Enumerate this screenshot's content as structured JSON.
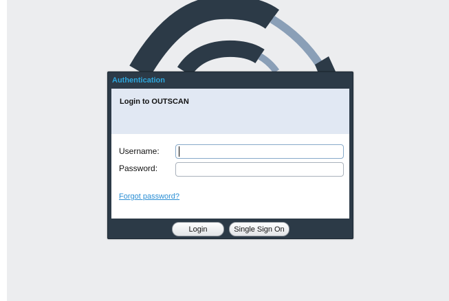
{
  "dialog": {
    "title": "Authentication",
    "heading": "Login to OUTSCAN"
  },
  "form": {
    "username_label": "Username:",
    "username_value": "",
    "password_label": "Password:",
    "password_value": "",
    "forgot_link": "Forgot password?"
  },
  "buttons": {
    "login": "Login",
    "single_sign_on": "Single Sign On"
  },
  "colors": {
    "dialog_frame": "#2c3a47",
    "title_accent": "#2ea6dc",
    "header_band": "#e1e8f3",
    "link": "#2a8ed4",
    "logo_dark": "#2c3a47",
    "logo_light": "#8a9fb7"
  },
  "logo": {
    "icon": "outscan-arcs-logo"
  }
}
